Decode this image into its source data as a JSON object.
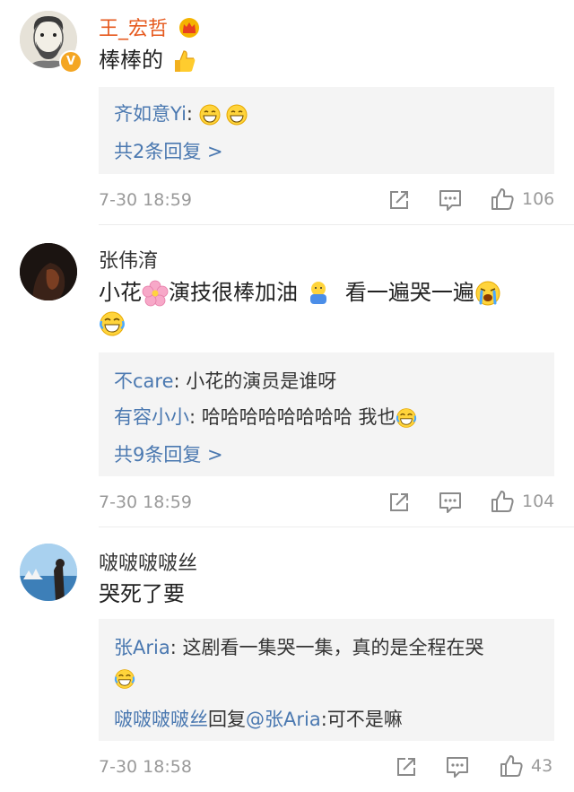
{
  "comments": [
    {
      "username": "王_宏哲",
      "username_color": "#e65a1f",
      "badge_icon": "crown-icon",
      "verified_icon": "verified-v-icon",
      "text_before": "棒棒的",
      "text_emoji": "thumbs-up-emoji",
      "replies": [
        {
          "author": "齐如意Yi",
          "sep": ":",
          "text": "",
          "emoji": [
            "grin-emoji",
            "grin-emoji"
          ]
        }
      ],
      "more_replies": "共2条回复 >",
      "time": "7-30 18:59",
      "likes": "106"
    },
    {
      "username": "张伟淯",
      "username_color": "#333333",
      "text_1": "小花",
      "text_2": "演技很棒加油",
      "text_3": "看一遍哭一遍",
      "replies": [
        {
          "author": "不care",
          "sep": ":",
          "text": " 小花的演员是谁呀"
        },
        {
          "author": "有容小小",
          "sep": ":",
          "text": " 哈哈哈哈哈哈哈哈 我也"
        }
      ],
      "more_replies": "共9条回复 >",
      "time": "7-30 18:59",
      "likes": "104"
    },
    {
      "username": "啵啵啵啵丝",
      "username_color": "#333333",
      "text": "哭死了要",
      "replies": [
        {
          "author": "张Aria",
          "sep": ":",
          "text": " 这剧看一集哭一集，真的是全程在哭"
        },
        {
          "author": "啵啵啵啵丝",
          "mid": "回复",
          "mention": "@张Aria",
          "text": ":可不是嘛"
        }
      ],
      "time": "7-30 18:58",
      "likes": "43"
    }
  ],
  "icons": {
    "share": "share-icon",
    "comment": "comment-icon",
    "like": "thumbs-up-icon"
  }
}
